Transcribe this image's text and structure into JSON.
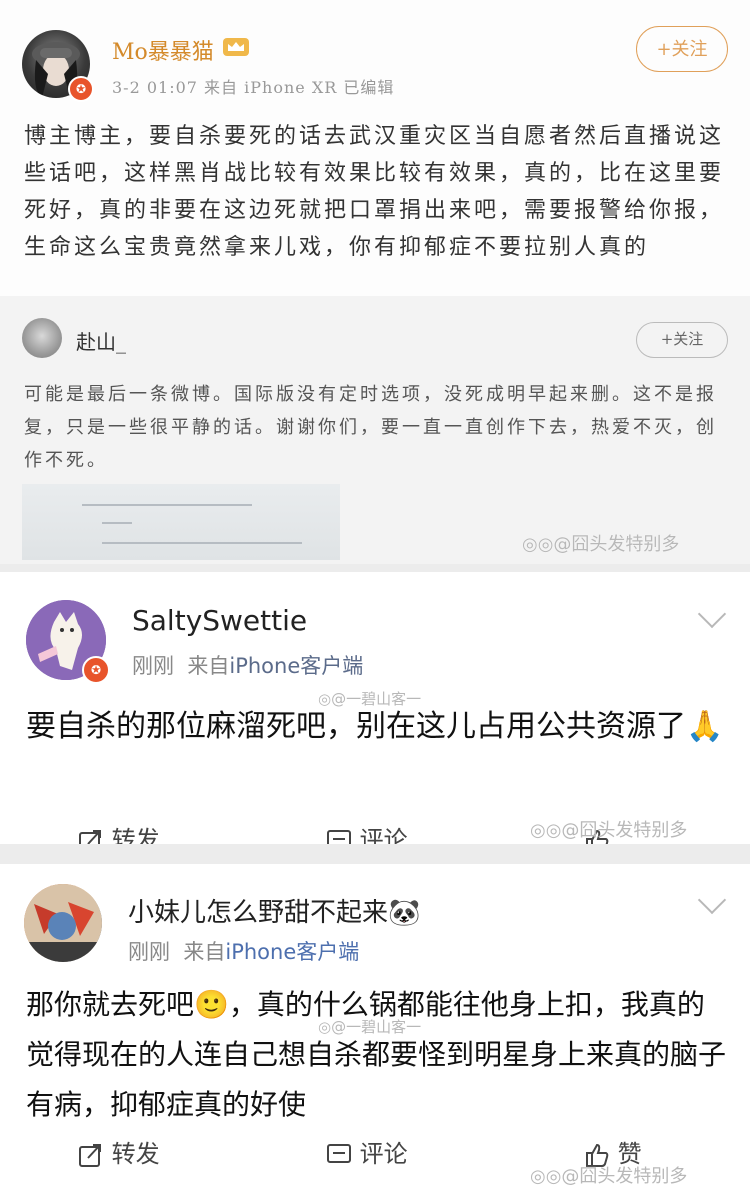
{
  "post1": {
    "username": "Mo暴暴猫",
    "meta": "3-2 01:07  来自 iPhone XR  已编辑",
    "follow_label": "+关注",
    "body": "博主博主，要自杀要死的话去武汉重灾区当自愿者然后直播说这些话吧，这样黑肖战比较有效果比较有效果，真的，比在这里要死好，真的非要在这边死就把口罩捐出来吧，需要报警给你报，生命这么宝贵竟然拿来儿戏，你有抑郁症不要拉别人真的"
  },
  "quoted_post": {
    "username": "赴山_",
    "follow_label": "+关注",
    "body": "可能是最后一条微博。国际版没有定时选项，没死成明早起来删。这不是报复，只是一些很平静的话。谢谢你们，要一直一直创作下去，热爱不灭，创作不死。"
  },
  "comment1": {
    "username": "SaltySwettie",
    "time": "刚刚",
    "source_prefix": "来自",
    "source": "iPhone客户端",
    "body": "要自杀的那位麻溜死吧，别在这儿占用公共资源了",
    "emoji": "🙏",
    "actions": {
      "repost": "转发",
      "comment": "评论"
    }
  },
  "comment2": {
    "username": "小妹儿怎么野甜不起来",
    "username_emoji": "🐼",
    "time": "刚刚",
    "source_prefix": "来自",
    "source": "iPhone客户端",
    "body_part1": "那你就去死吧",
    "emoji": "🙂",
    "body_part2": "，真的什么锅都能往他身上扣，我真的觉得现在的人连自己想自杀都要怪到明星身上来真的脑子有病，抑郁症真的好使",
    "actions": {
      "repost": "转发",
      "comment": "评论",
      "like": "赞"
    }
  },
  "watermarks": {
    "main": "@囧头发特别多",
    "secondary": "@一碧山客一"
  },
  "colors": {
    "username_orange": "#d48a2b",
    "follow_orange": "#e0a05a",
    "source_blue": "#4d6fae",
    "badge_red": "#e8542b"
  }
}
